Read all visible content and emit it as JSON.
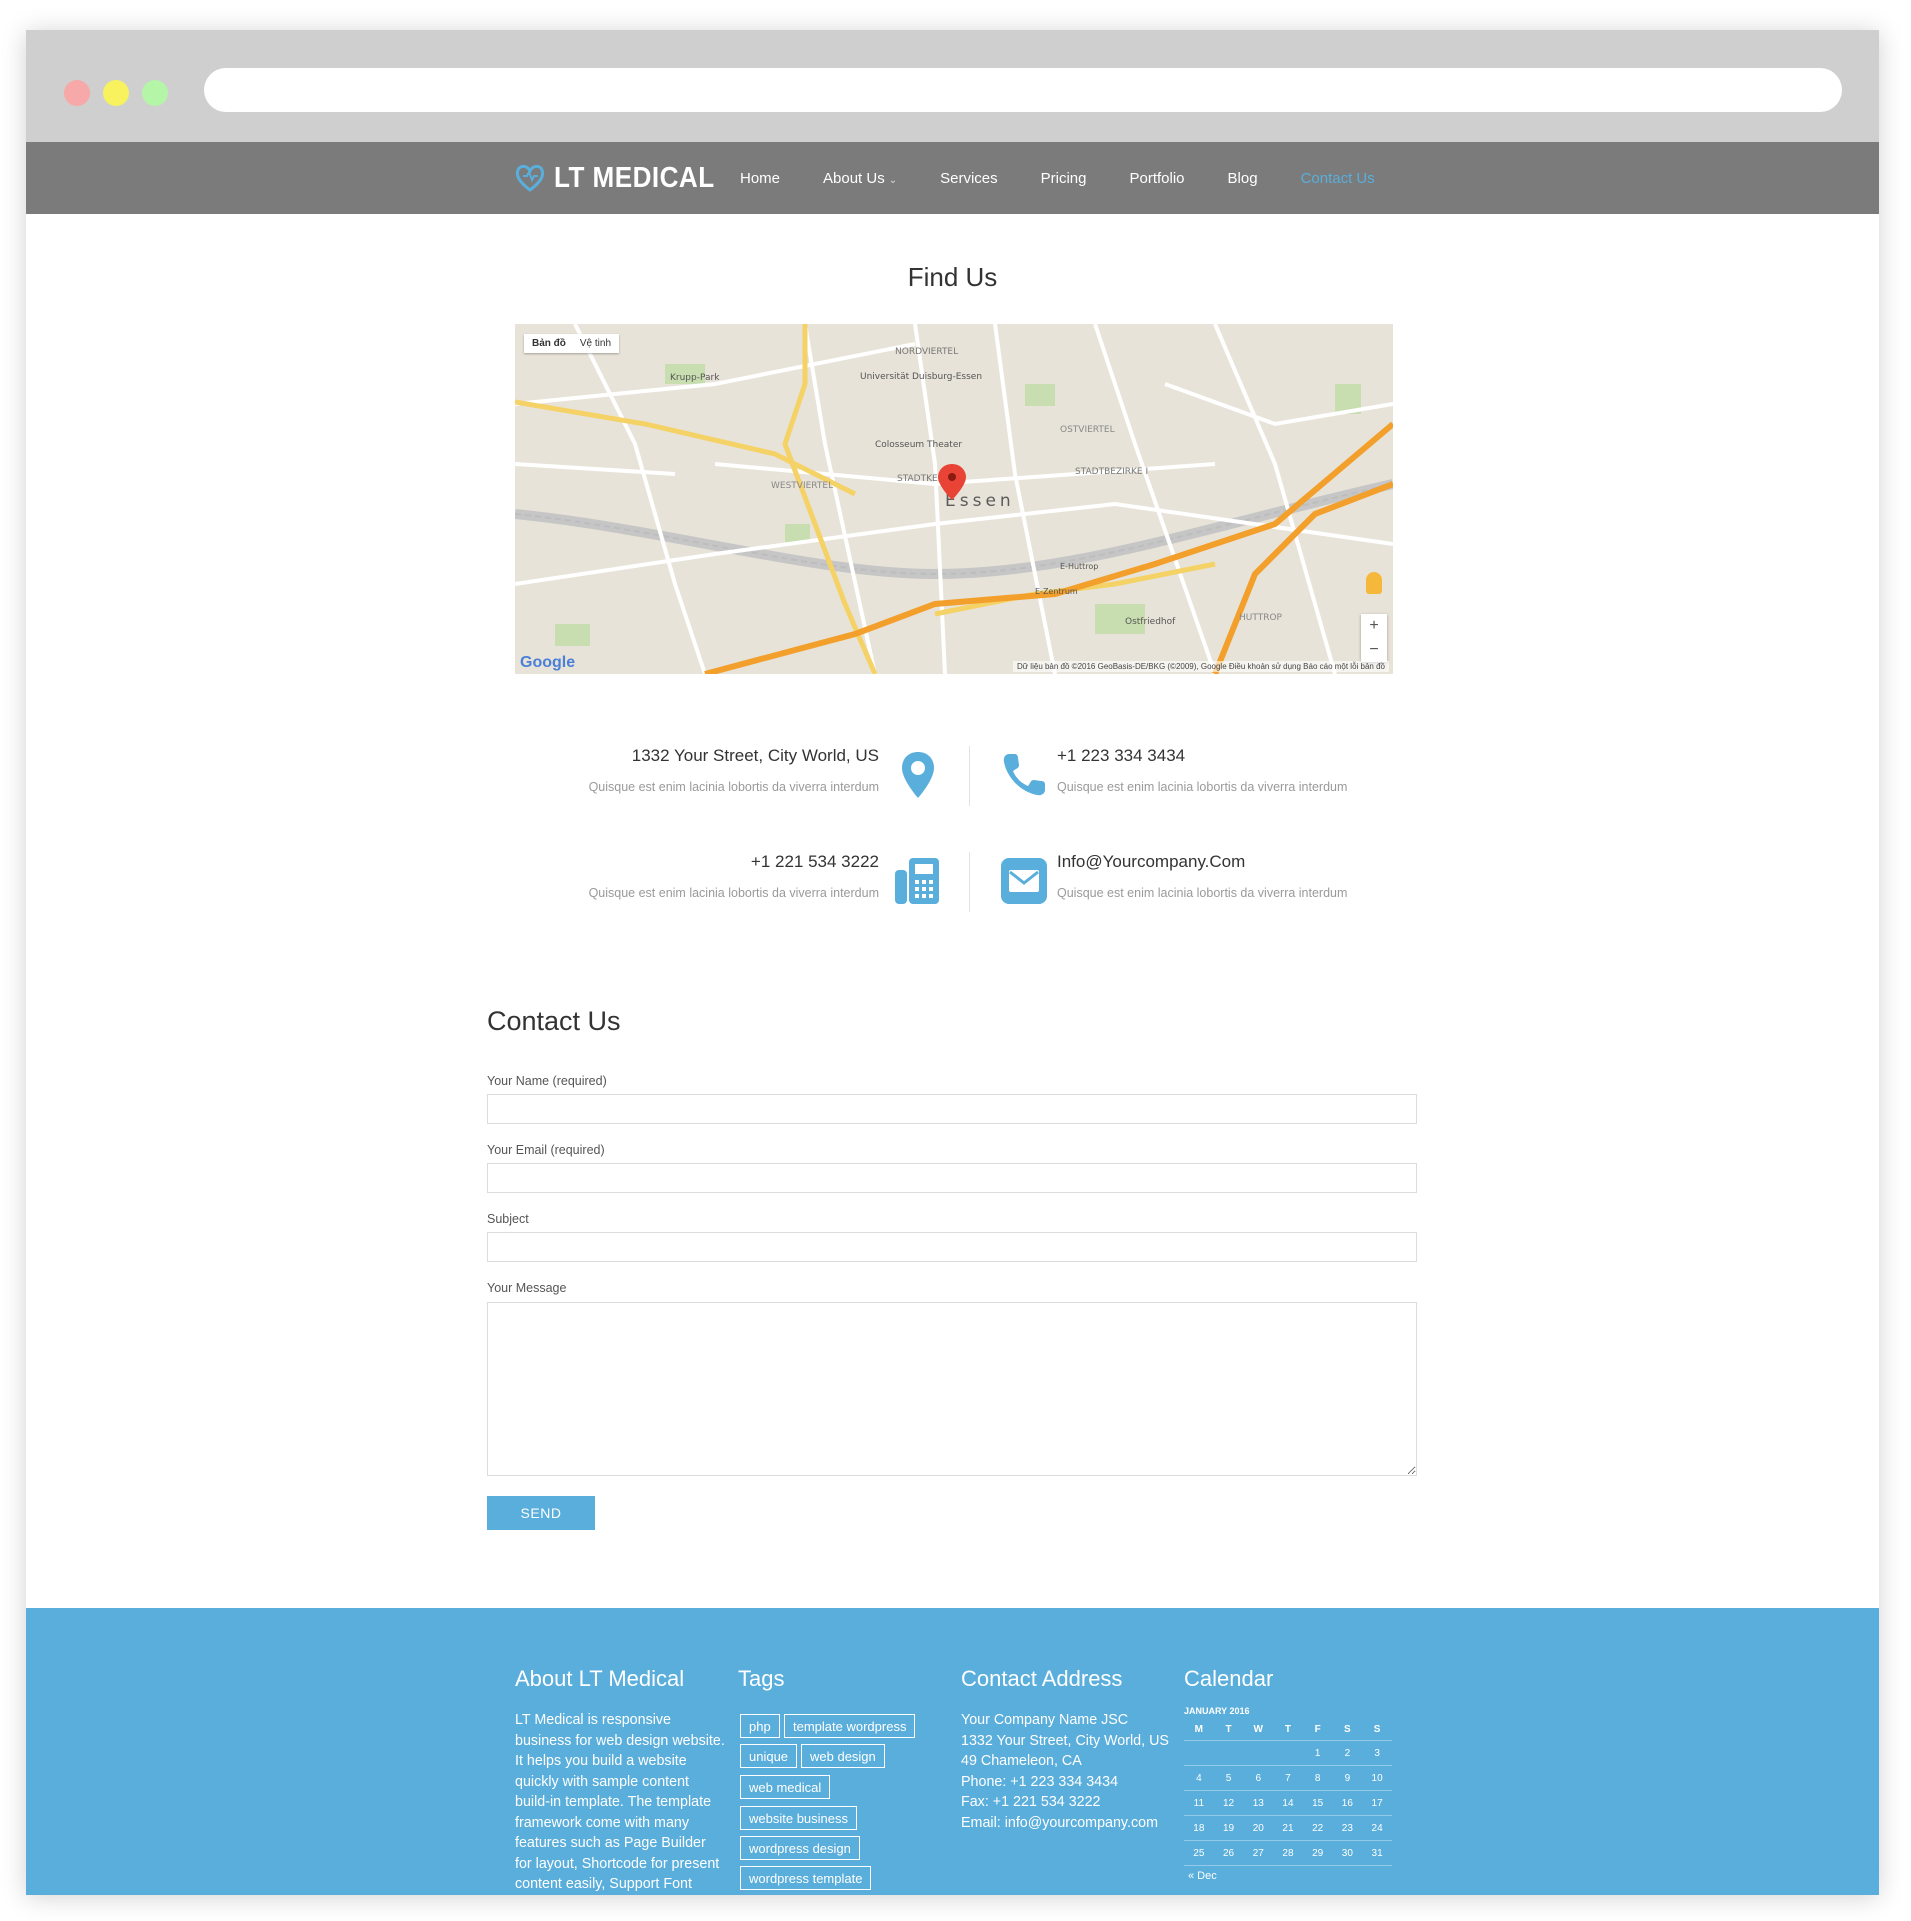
{
  "browser": {
    "dots": [
      "#f7a8a8",
      "#f7f25e",
      "#b5f5a8"
    ]
  },
  "nav": {
    "logo_text": "LT MEDICAL",
    "items": [
      {
        "label": "Home",
        "active": false,
        "has_dropdown": false
      },
      {
        "label": "About Us",
        "active": false,
        "has_dropdown": true
      },
      {
        "label": "Services",
        "active": false,
        "has_dropdown": false
      },
      {
        "label": "Pricing",
        "active": false,
        "has_dropdown": false
      },
      {
        "label": "Portfolio",
        "active": false,
        "has_dropdown": false
      },
      {
        "label": "Blog",
        "active": false,
        "has_dropdown": false
      },
      {
        "label": "Contact Us",
        "active": true,
        "has_dropdown": false
      }
    ],
    "accent": "#5aaedc"
  },
  "find_us": {
    "title": "Find Us",
    "map": {
      "toggle_map": "Bản đồ",
      "toggle_satellite": "Vệ tinh",
      "city_label": "Essen",
      "footer": "Dữ liệu bản đồ ©2016 GeoBasis-DE/BKG (©2009), Google   Điều khoản sử dụng   Báo cáo một lỗi bản đồ",
      "google": "Google",
      "zoom_in": "+",
      "zoom_out": "−",
      "labels": [
        "NORDVIERTEL",
        "Universität Duisburg-Essen",
        "Colosseum Theater",
        "STADTKERN",
        "WESTVIERTEL",
        "OSTVIERTEL",
        "STADTBEZIRKE I",
        "HUTTROP",
        "Krupp-Park",
        "Ostfriedhof",
        "E-Zentrum",
        "E-Huttrop"
      ]
    }
  },
  "info": [
    {
      "title": "1332 Your Street, City World, US",
      "desc": "Quisque est enim lacinia lobortis da viverra interdum",
      "icon": "map-marker-icon"
    },
    {
      "title": "+1 223 334 3434",
      "desc": "Quisque est enim lacinia lobortis da viverra interdum",
      "icon": "phone-icon"
    },
    {
      "title": "+1 221 534 3222",
      "desc": "Quisque est enim lacinia lobortis da viverra interdum",
      "icon": "fax-icon"
    },
    {
      "title": "Info@Yourcompany.Com",
      "desc": "Quisque est enim lacinia lobortis da viverra interdum",
      "icon": "envelope-icon"
    }
  ],
  "contact": {
    "title": "Contact Us",
    "name_label": "Your Name (required)",
    "email_label": "Your Email (required)",
    "subject_label": "Subject",
    "message_label": "Your Message",
    "name_value": "",
    "email_value": "",
    "subject_value": "",
    "message_value": "",
    "send_label": "SEND"
  },
  "footer": {
    "about": {
      "title": "About LT Medical",
      "text": "LT Medical is responsive business for web design website. It helps you build a website quickly with sample content build-in template. The template framework come with many features such as Page Builder for layout, Shortcode for present content easily, Support Font Awesome, Compress files"
    },
    "tags": {
      "title": "Tags",
      "items": [
        "php",
        "template wordpress",
        "unique",
        "web design",
        "web medical",
        "website business",
        "wordpress design",
        "wordpress template"
      ]
    },
    "contact": {
      "title": "Contact Address",
      "lines": [
        "Your Company Name JSC",
        "1332 Your Street, City World, US",
        "49 Chameleon, CA",
        "Phone: +1 223 334 3434",
        "Fax: +1 221 534 3222",
        "Email: info@yourcompany.com"
      ]
    },
    "calendar": {
      "title": "Calendar",
      "caption": "JANUARY 2016",
      "weekdays": [
        "M",
        "T",
        "W",
        "T",
        "F",
        "S",
        "S"
      ],
      "weeks": [
        [
          "",
          "",
          "",
          "",
          "1",
          "2",
          "3"
        ],
        [
          "4",
          "5",
          "6",
          "7",
          "8",
          "9",
          "10"
        ],
        [
          "11",
          "12",
          "13",
          "14",
          "15",
          "16",
          "17"
        ],
        [
          "18",
          "19",
          "20",
          "21",
          "22",
          "23",
          "24"
        ],
        [
          "25",
          "26",
          "27",
          "28",
          "29",
          "30",
          "31"
        ]
      ],
      "prev": "« Dec"
    },
    "bg_color": "#5aaedc"
  }
}
